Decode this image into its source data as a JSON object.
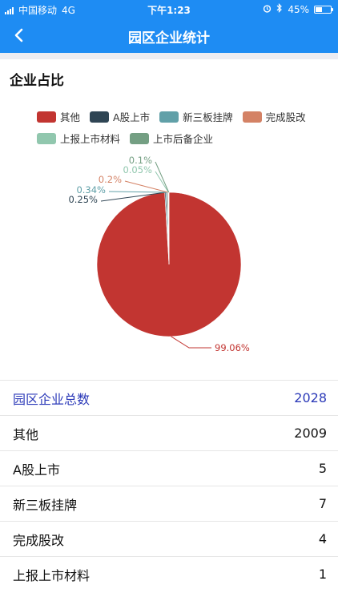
{
  "status_bar": {
    "carrier": "中国移动",
    "network": "4G",
    "time": "下午1:23",
    "battery_text": "45%",
    "battery_level": 0.45
  },
  "nav": {
    "title": "园区企业统计",
    "back_icon": "chevron-left-icon"
  },
  "section": {
    "title": "企业占比"
  },
  "colors": {
    "primary": "#1e8cf3",
    "total_text": "#2b39b8"
  },
  "chart_data": {
    "type": "pie",
    "categories": [
      "其他",
      "A股上市",
      "新三板挂牌",
      "完成股改",
      "上报上市材料",
      "上市后备企业"
    ],
    "values": [
      2009,
      5,
      7,
      4,
      1,
      2
    ],
    "percent_labels": [
      "99.06%",
      "0.25%",
      "0.34%",
      "0.2%",
      "0.05%",
      "0.1%"
    ],
    "colors": [
      "#c23531",
      "#2f4554",
      "#61a0a8",
      "#d48265",
      "#91c7ae",
      "#749f83"
    ],
    "legend_position": "top"
  },
  "table": {
    "total": {
      "label": "园区企业总数",
      "value": "2028"
    },
    "rows": [
      {
        "label": "其他",
        "value": "2009"
      },
      {
        "label": "A股上市",
        "value": "5"
      },
      {
        "label": "新三板挂牌",
        "value": "7"
      },
      {
        "label": "完成股改",
        "value": "4"
      },
      {
        "label": "上报上市材料",
        "value": "1"
      }
    ]
  }
}
